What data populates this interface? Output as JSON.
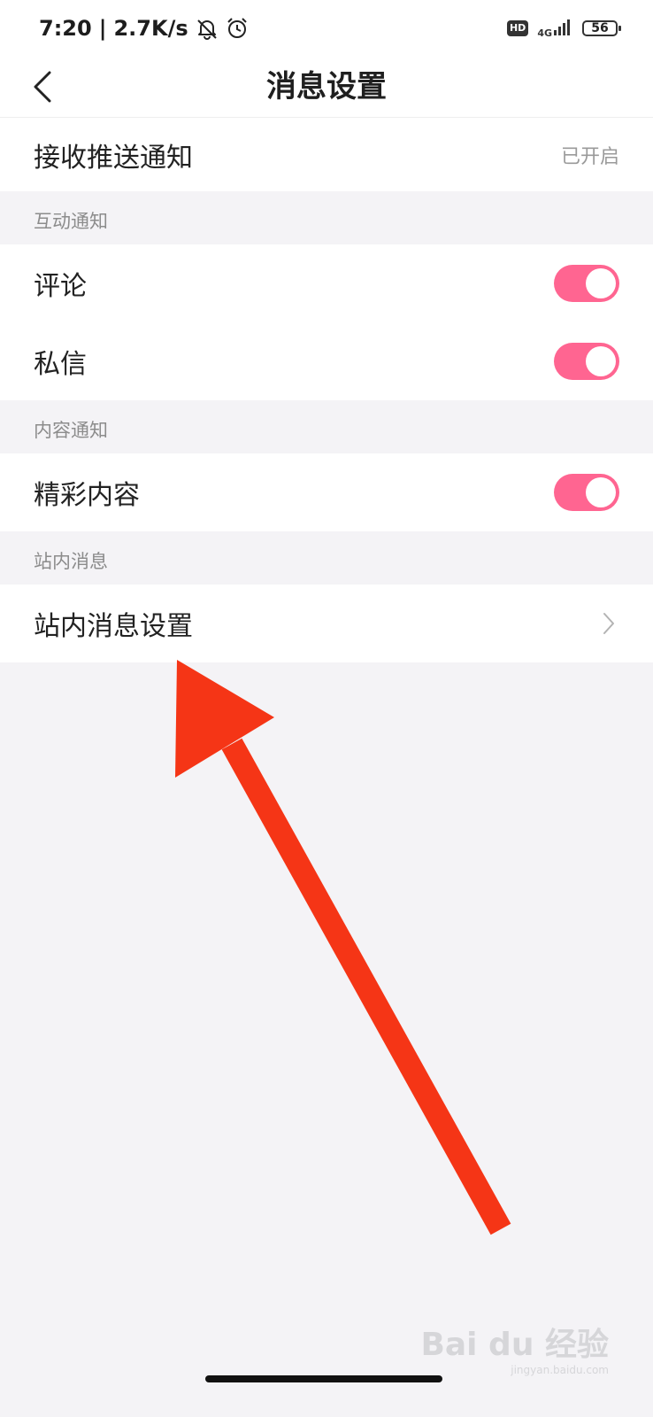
{
  "status_bar": {
    "time": "7:20",
    "separator": "|",
    "net_speed": "2.7K/s",
    "hd_label": "HD",
    "network_label": "4G",
    "battery_level": "56",
    "icons": [
      "bell-off-icon",
      "alarm-clock-icon",
      "signal-icon",
      "battery-icon"
    ]
  },
  "nav": {
    "title": "消息设置",
    "back_icon": "chevron-left-icon"
  },
  "push": {
    "label": "接收推送通知",
    "value": "已开启"
  },
  "sections": {
    "interaction": {
      "header": "互动通知",
      "comment_label": "评论",
      "comment_on": true,
      "dm_label": "私信",
      "dm_on": true
    },
    "content": {
      "header": "内容通知",
      "featured_label": "精彩内容",
      "featured_on": true
    },
    "station": {
      "header": "站内消息",
      "settings_label": "站内消息设置",
      "chevron_icon": "chevron-right-icon"
    }
  },
  "watermark": {
    "text": "Bai du 经验",
    "sub": "jingyan.baidu.com"
  },
  "colors": {
    "accent": "#ff6591",
    "annotation": "#f53516",
    "background": "#f4f3f6"
  }
}
